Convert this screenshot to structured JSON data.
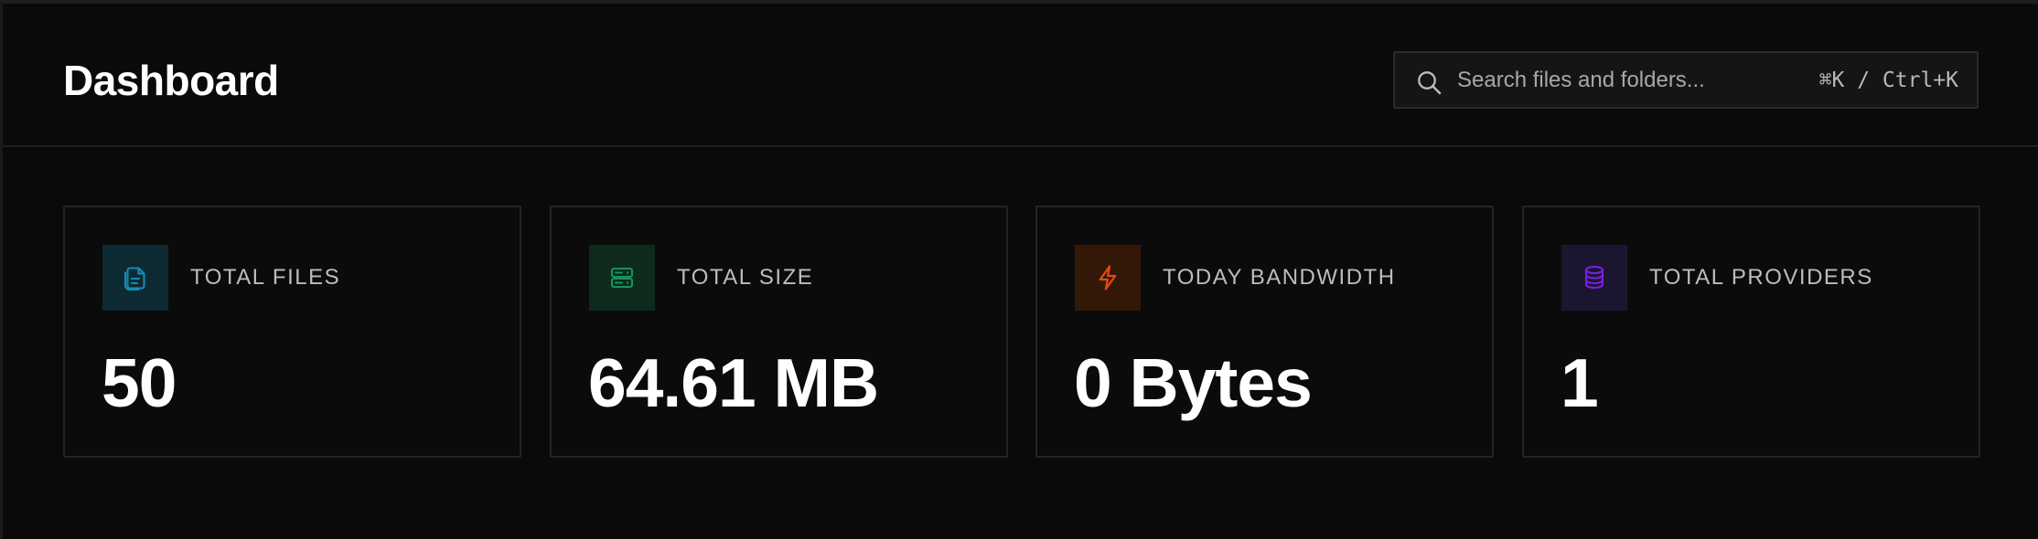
{
  "header": {
    "title": "Dashboard"
  },
  "search": {
    "placeholder": "Search files and folders...",
    "icon": "search-icon",
    "shortcut": "⌘K / Ctrl+K"
  },
  "stats": [
    {
      "label": "TOTAL FILES",
      "value": "50",
      "icon": "files-icon",
      "accent": "#168ab7",
      "background": "#0d2a32"
    },
    {
      "label": "TOTAL SIZE",
      "value": "64.61 MB",
      "icon": "server-icon",
      "accent": "#16935b",
      "background": "#0d2a1d"
    },
    {
      "label": "TODAY BANDWIDTH",
      "value": "0 Bytes",
      "icon": "lightning-icon",
      "accent": "#e24b12",
      "background": "#331807"
    },
    {
      "label": "TOTAL PROVIDERS",
      "value": "1",
      "icon": "database-icon",
      "accent": "#7b1fe0",
      "background": "#1c1530"
    }
  ]
}
